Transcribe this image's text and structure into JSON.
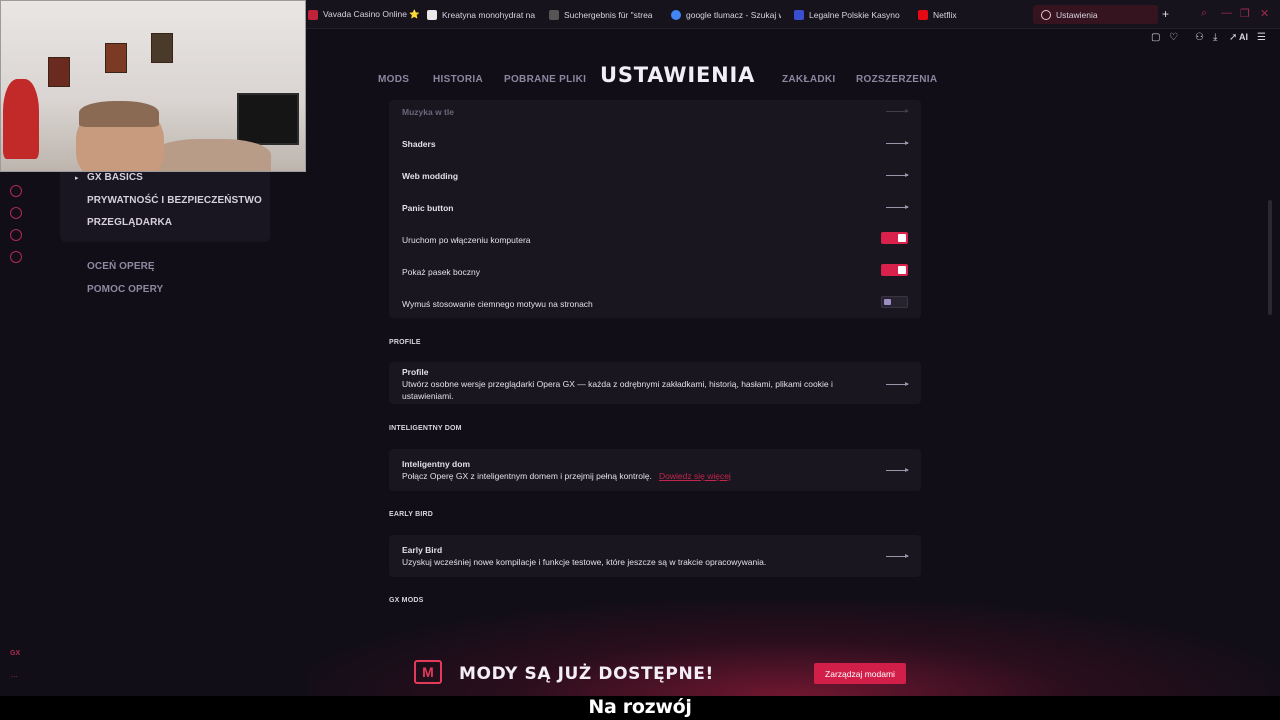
{
  "browser": {
    "tabs": [
      {
        "label": "Vavada Casino Online ⭐",
        "color": "#c0223a"
      },
      {
        "label": "Kreatyna monohydrat na",
        "color": "#e8e8e8"
      },
      {
        "label": "Suchergebnis für \"strea",
        "color": "#555555"
      },
      {
        "label": "google tlumacz - Szukaj w",
        "color": "#4285f4"
      },
      {
        "label": "Legalne Polskie Kasyno",
        "color": "#3a4fd0"
      },
      {
        "label": "Netflix",
        "color": "#e50914"
      }
    ],
    "active_tab": "Ustawienia",
    "new_tab_icon": "plus-icon",
    "ai_label": "AI"
  },
  "topnav": {
    "items": [
      "MODS",
      "HISTORIA",
      "POBRANE PLIKI",
      "ZAKŁADKI",
      "ROZSZERZENIA"
    ],
    "title": "USTAWIENIA"
  },
  "sidenav": {
    "items": [
      "GX BASICS",
      "PRYWATNOŚĆ I BEZPIECZEŃSTWO",
      "PRZEGLĄDARKA"
    ],
    "secondary": [
      "OCEŃ OPERĘ",
      "POMOC OPERY"
    ]
  },
  "settings": {
    "rows": [
      {
        "label": "Muzyka w tle",
        "control": "arrow"
      },
      {
        "label": "Shaders",
        "control": "arrow"
      },
      {
        "label": "Web modding",
        "control": "arrow"
      },
      {
        "label": "Panic button",
        "control": "arrow"
      },
      {
        "label": "Uruchom po włączeniu komputera",
        "control": "toggle",
        "value": true
      },
      {
        "label": "Pokaż pasek boczny",
        "control": "toggle",
        "value": true
      },
      {
        "label": "Wymuś stosowanie ciemnego motywu na stronach",
        "control": "toggle",
        "value": false
      }
    ],
    "sections": [
      {
        "heading": "PROFILE",
        "title": "Profile",
        "description": "Utwórz osobne wersje przeglądarki Opera GX — każda z odrębnymi zakładkami, historią, hasłami, plikami cookie i ustawieniami."
      },
      {
        "heading": "INTELIGENTNY DOM",
        "title": "Inteligentny dom",
        "description": "Połącz Operę GX z inteligentnym domem i przejmij pełną kontrolę.",
        "link": "Dowiedz się więcej"
      },
      {
        "heading": "EARLY BIRD",
        "title": "Early Bird",
        "description": "Uzyskuj wcześniej nowe kompilacje i funkcje testowe, które jeszcze są w trakcie opracowywania."
      },
      {
        "heading": "GX MODS"
      }
    ]
  },
  "banner": {
    "logo_letter": "M",
    "text": "MODY SĄ JUŻ DOSTĘPNE!",
    "button": "Zarządzaj modami"
  },
  "left_rail": {
    "gx_label": "GX",
    "more_label": "..."
  },
  "subtitle": "Na rozwój",
  "colors": {
    "accent": "#d8224c",
    "background": "#110e17",
    "card": "#19161f"
  }
}
